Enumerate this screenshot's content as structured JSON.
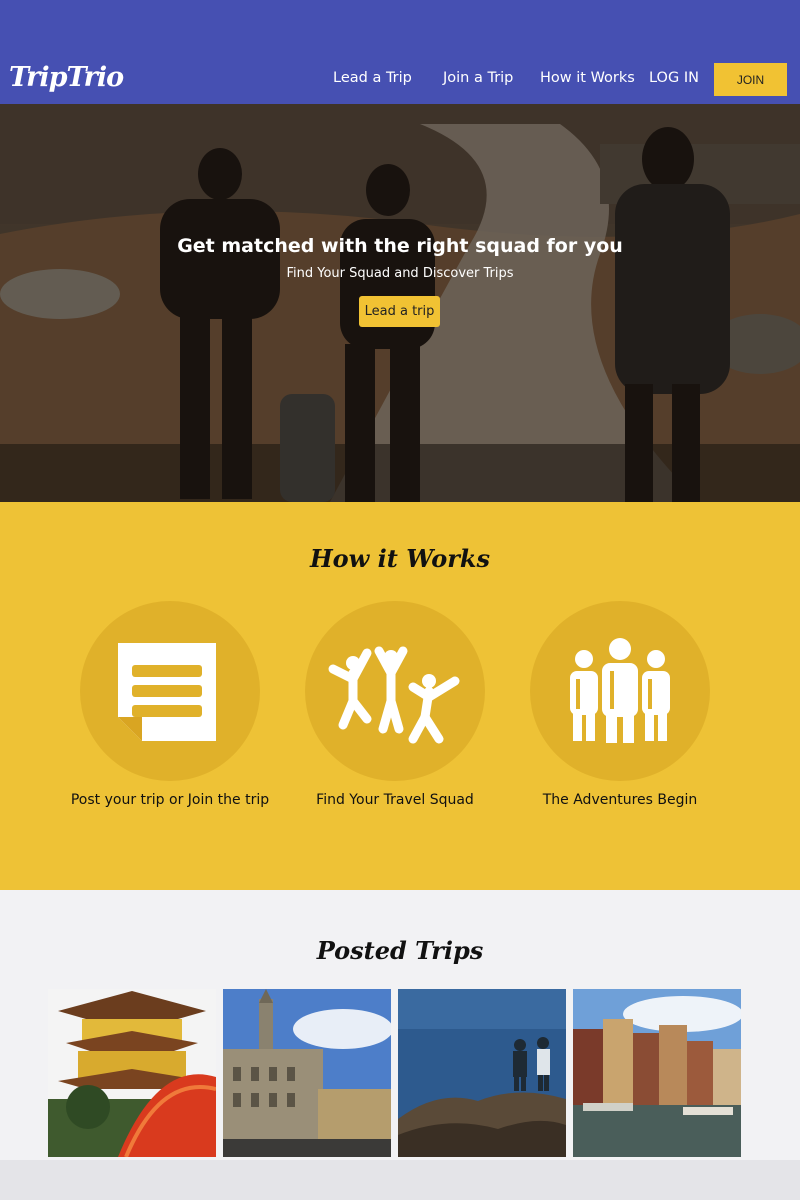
{
  "brand": {
    "logo": "TripTrio"
  },
  "nav": {
    "lead": "Lead a Trip",
    "join": "Join a Trip",
    "how": "How it Works",
    "login": "LOG IN",
    "join_button": "JOIN"
  },
  "hero": {
    "title": "Get matched with the right squad for you",
    "subtitle": "Find Your Squad and Discover Trips",
    "cta": "Lead a trip"
  },
  "how_it_works": {
    "title": "How it Works",
    "steps": [
      {
        "label": "Post your trip or Join the trip",
        "icon": "document-icon"
      },
      {
        "label": "Find Your Travel Squad",
        "icon": "jumping-people-icon"
      },
      {
        "label": "The Adventures Begin",
        "icon": "hikers-icon"
      }
    ]
  },
  "posted_trips": {
    "title": "Posted Trips",
    "photos": [
      "pagoda-photo",
      "grand-place-photo",
      "seaside-rocks-photo",
      "canal-city-photo"
    ]
  },
  "colors": {
    "nav_bg": "#4650b2",
    "accent_yellow": "#f1c233",
    "section_yellow": "#eec236",
    "circle_yellow": "#e0b12a"
  }
}
